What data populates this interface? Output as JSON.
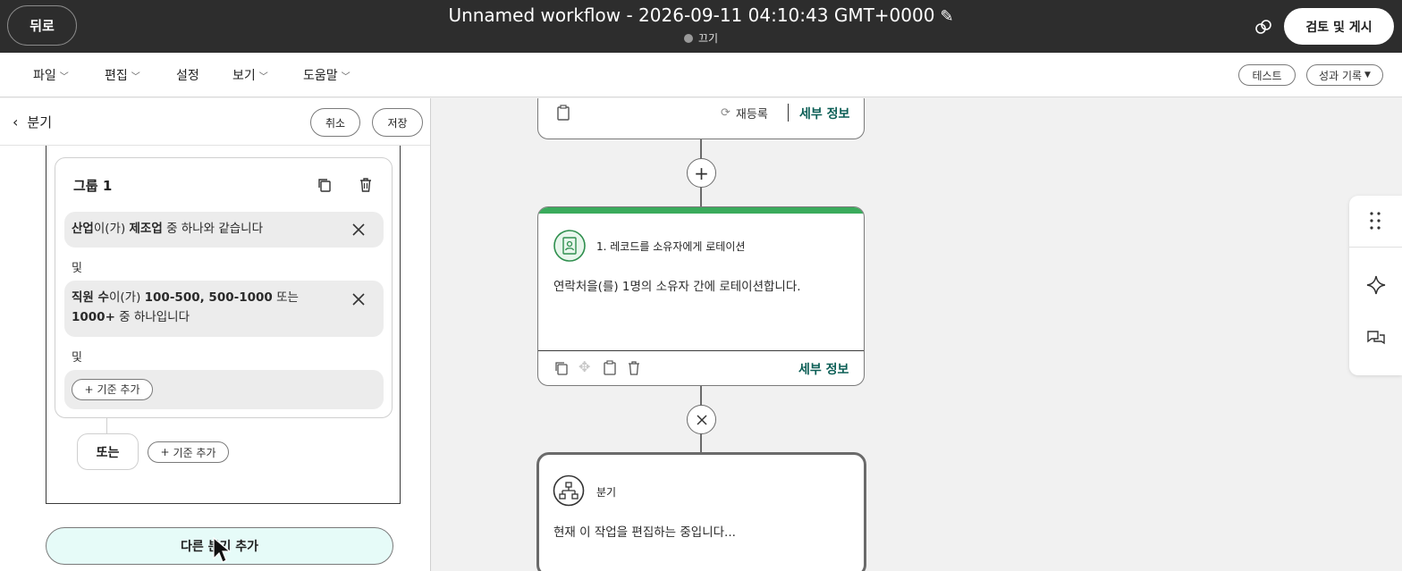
{
  "topbar": {
    "back_label": "뒤로",
    "title": "Unnamed workflow - 2026-09-11 04:10:43 GMT+0000",
    "status": "끄기",
    "publish_label": "검토 및 게시"
  },
  "menu": {
    "file": "파일",
    "edit": "편집",
    "settings": "설정",
    "view": "보기",
    "help": "도움말",
    "test": "테스트",
    "performance": "성과 기록"
  },
  "panel": {
    "title": "분기",
    "cancel": "취소",
    "save": "저장",
    "group_title": "그룹 1",
    "cond1": {
      "field": "산업",
      "p1": "이(가) ",
      "value": "제조업",
      "p2": " 중 하나와 같습니다"
    },
    "and1": "및",
    "cond2": {
      "field": "직원 수",
      "p1": "이(가) ",
      "value": "100-500, 500-1000",
      "p2": " 또는",
      "value2": "1000+",
      "p3": " 중 하나입니다"
    },
    "and2": "및",
    "add_criteria": "기준 추가",
    "or_label": "또는",
    "add_criteria_or": "기준 추가",
    "add_branch": "다른 분기 추가"
  },
  "canvas": {
    "top_node": {
      "reenroll": "재등록",
      "details": "세부 정보"
    },
    "rotate_node": {
      "title": "1. 레코드를 소유자에게 로테이션",
      "description": "연락처을(를) 1명의 소유자 간에 로테이션합니다.",
      "details": "세부 정보"
    },
    "branch_node": {
      "title": "분기",
      "description": "현재 이 작업을 편집하는 중입니다..."
    }
  },
  "colors": {
    "topbar_bg": "#2d2d2d",
    "accent_green": "#3aab5c",
    "link_teal": "#0b5e55",
    "add_branch_bg": "#e6fbf8"
  }
}
